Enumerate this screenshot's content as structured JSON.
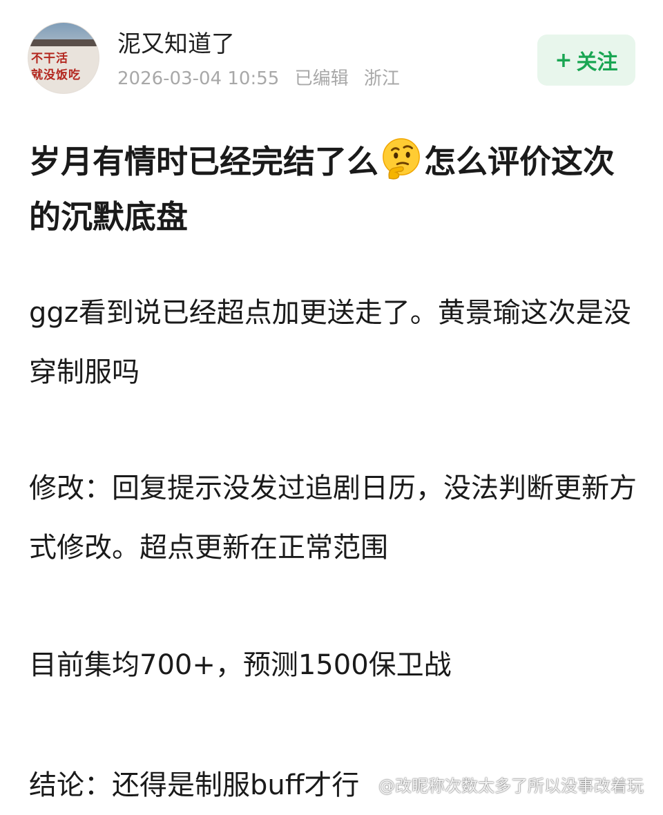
{
  "post": {
    "author": {
      "name": "泥又知道了",
      "avatar_sign_lines": [
        "不干活",
        "就没饭吃"
      ]
    },
    "meta": {
      "timestamp": "2026-03-04 10:55",
      "edited_label": "已编辑",
      "location": "浙江"
    },
    "follow_button": {
      "icon": "+",
      "label": "关注"
    },
    "title_part1": "岁月有情时已经完结了么",
    "title_emoji": "thinking-face-icon",
    "title_part2": "怎么评价这次的沉默底盘",
    "paragraphs": [
      "ggz看到说已经超点加更送走了。黄景瑜这次是没穿制服吗",
      "修改：回复提示没发过追剧日历，没法判断更新方式修改。超点更新在正常范围",
      "目前集均700+，预测1500保卫战",
      "结论：还得是制服buff才行"
    ]
  },
  "watermark": "@改昵称次数太多了所以没事改着玩",
  "colors": {
    "follow_bg": "#e8f6ec",
    "follow_text": "#1aa653",
    "meta_text": "#a8a8a8",
    "body_text": "#1a1a1a"
  }
}
